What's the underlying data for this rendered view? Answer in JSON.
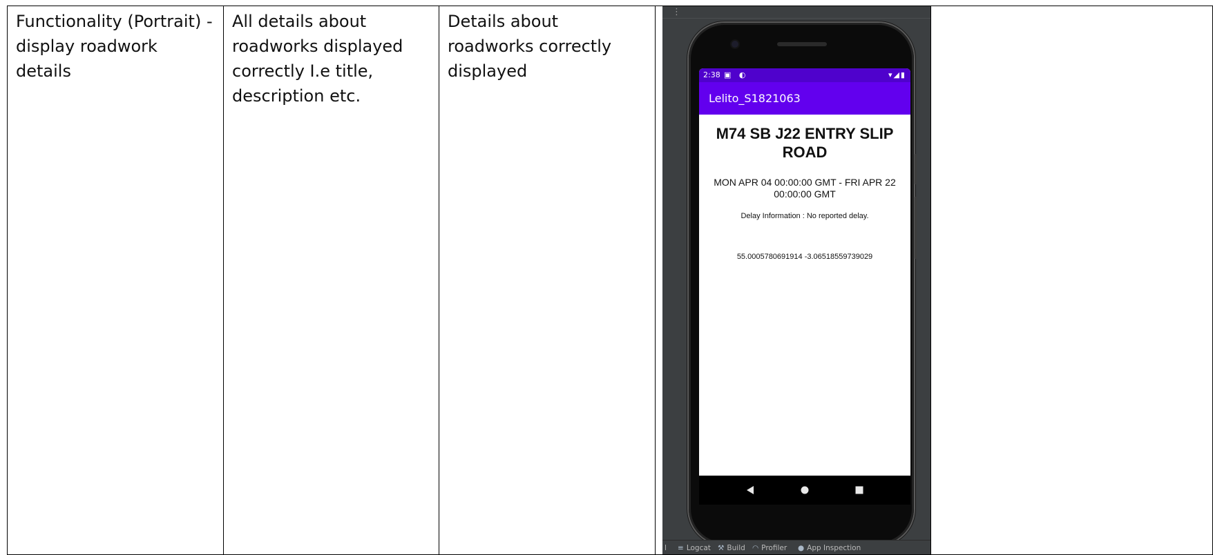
{
  "test_row": {
    "feature": "Functionality (Portrait) - display roadwork details",
    "expected_result": "All details about roadworks displayed correctly I.e title, description etc.",
    "actual_result": "Details about roadworks correctly displayed",
    "comments": ""
  },
  "emulator": {
    "status_bar": {
      "time": "2:38",
      "left_icons": "▣ ◐",
      "right_icons": "▾◢▮"
    },
    "app_title": "Lelito_S1821063",
    "roadwork": {
      "title": "M74 SB J22 ENTRY SLIP ROAD",
      "dates": "MON APR 04 00:00:00 GMT - FRI APR 22 00:00:00 GMT",
      "delay": "Delay Information : No reported delay.",
      "coordinates": "55.0005780691914 -3.06518559739029"
    },
    "nav_bar": {
      "back_icon": "back-triangle",
      "home_icon": "home-circle",
      "recents_icon": "recents-square"
    },
    "toolbar": {
      "edge_label": "l",
      "items": [
        {
          "label": "Logcat",
          "icon": "logcat-icon"
        },
        {
          "label": "Build",
          "icon": "hammer-icon"
        },
        {
          "label": "Profiler",
          "icon": "gauge-icon"
        },
        {
          "label": "App Inspection",
          "icon": "inspection-icon"
        }
      ]
    }
  },
  "colors": {
    "app_bar": "#6200ee",
    "status_bar": "#4f02cc",
    "ide_background": "#3c3f41"
  }
}
